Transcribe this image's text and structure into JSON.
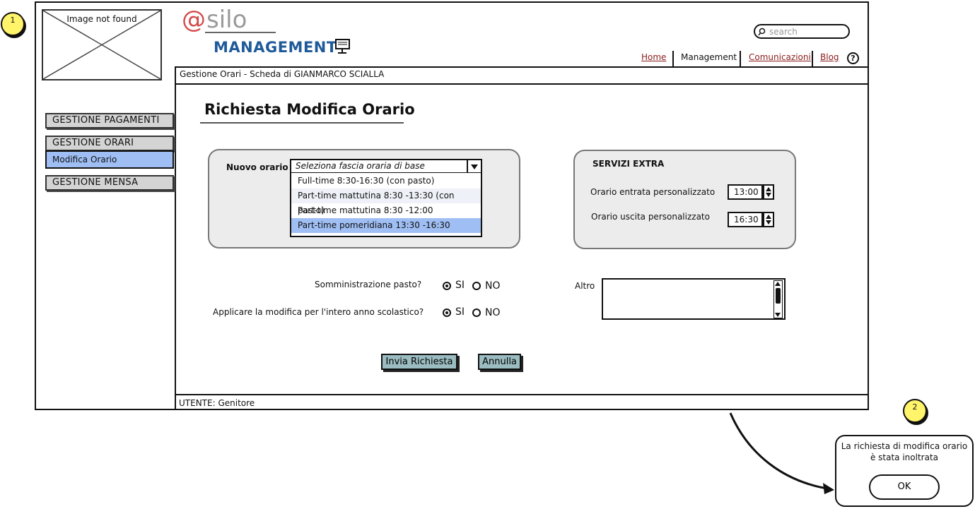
{
  "annotations": {
    "note1": "1",
    "note2": "2"
  },
  "image_placeholder": "Image not found",
  "logo": {
    "at": "@",
    "name": "silo",
    "subtitle": "MANAGEMENT",
    "icon": "monitor-icon"
  },
  "search": {
    "placeholder": "search",
    "icon": "search-icon"
  },
  "nav": {
    "home": "Home",
    "management": "Management",
    "comunicazioni": "Comunicazioni",
    "blog": "Blog",
    "help": "?"
  },
  "breadcrumb": "Gestione Orari - Scheda di GIANMARCO SCIALLA",
  "sidebar": {
    "pagamenti": "GESTIONE PAGAMENTI",
    "orari": "GESTIONE ORARI",
    "modifica_orario": "Modifica Orario",
    "mensa": "GESTIONE MENSA"
  },
  "page_title": "Richiesta Modifica Orario",
  "nuovo_orario": {
    "label": "Nuovo orario",
    "selected": "Seleziona fascia oraria di base",
    "options": [
      "Full-time 8:30-16:30 (con pasto)",
      "Part-time mattutina 8:30 -13:30 (con pasto)",
      "Part-time mattutina 8:30 -12:00",
      "Part-time pomeridiana 13:30 -16:30"
    ]
  },
  "servizi_extra": {
    "title": "SERVIZI EXTRA",
    "entrata_label": "Orario entrata personalizzato",
    "entrata_value": "13:00",
    "uscita_label": "Orario uscita personalizzato",
    "uscita_value": "16:30"
  },
  "questions": {
    "pasto": "Somministrazione pasto?",
    "anno": "Applicare la modifica per l'intero anno scolastico?",
    "si": "SI",
    "no": "NO"
  },
  "altro": {
    "label": "Altro",
    "value": ""
  },
  "buttons": {
    "invia": "Invia Richiesta",
    "annulla": "Annulla"
  },
  "footer": "UTENTE: Genitore",
  "dialog": {
    "message": "La richiesta di modifica orario è stata inoltrata",
    "ok": "OK"
  },
  "colors": {
    "selected_item": "#9fbef3",
    "button": "#9bbcc0",
    "logo_at": "#d34a4a",
    "logo_management": "#1f5a9a",
    "link": "#8b1c1c"
  }
}
